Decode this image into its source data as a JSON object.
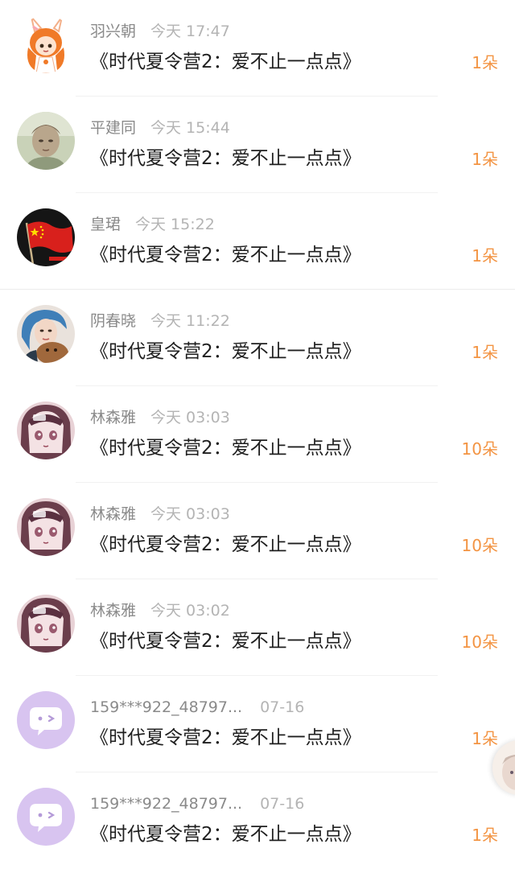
{
  "records": [
    {
      "avatar": "anime-girl-orange-avatar",
      "name": "羽兴朝",
      "time": "今天 17:47",
      "title": "《时代夏令营2：爱不止一点点》",
      "count": "1朵"
    },
    {
      "avatar": "young-man-photo-avatar",
      "name": "平建同",
      "time": "今天 15:44",
      "title": "《时代夏令营2：爱不止一点点》",
      "count": "1朵"
    },
    {
      "avatar": "red-flag-avatar",
      "name": "皇珺",
      "time": "今天 15:22",
      "title": "《时代夏令营2：爱不止一点点》",
      "count": "1朵"
    },
    {
      "avatar": "blue-hair-girl-photo-avatar",
      "name": "阴春晓",
      "time": "今天 11:22",
      "title": "《时代夏令营2：爱不止一点点》",
      "count": "1朵"
    },
    {
      "avatar": "anime-girl-pink-avatar",
      "name": "林森雅",
      "time": "今天 03:03",
      "title": "《时代夏令营2：爱不止一点点》",
      "count": "10朵"
    },
    {
      "avatar": "anime-girl-pink-avatar",
      "name": "林森雅",
      "time": "今天 03:03",
      "title": "《时代夏令营2：爱不止一点点》",
      "count": "10朵"
    },
    {
      "avatar": "anime-girl-pink-avatar",
      "name": "林森雅",
      "time": "今天 03:02",
      "title": "《时代夏令营2：爱不止一点点》",
      "count": "10朵"
    },
    {
      "avatar": "default-chat-bubble-avatar",
      "name": "159***922_48797...",
      "time": "07-16",
      "title": "《时代夏令营2：爱不止一点点》",
      "count": "1朵"
    },
    {
      "avatar": "default-chat-bubble-avatar",
      "name": "159***922_48797...",
      "time": "07-16",
      "title": "《时代夏令营2：爱不止一点点》",
      "count": "1朵"
    }
  ],
  "colors": {
    "accent": "#f39443",
    "name": "#8a8a8a",
    "time": "#b4b4b4",
    "title": "#1f1f1f",
    "default_avatar_bg": "#d8c4f0"
  }
}
